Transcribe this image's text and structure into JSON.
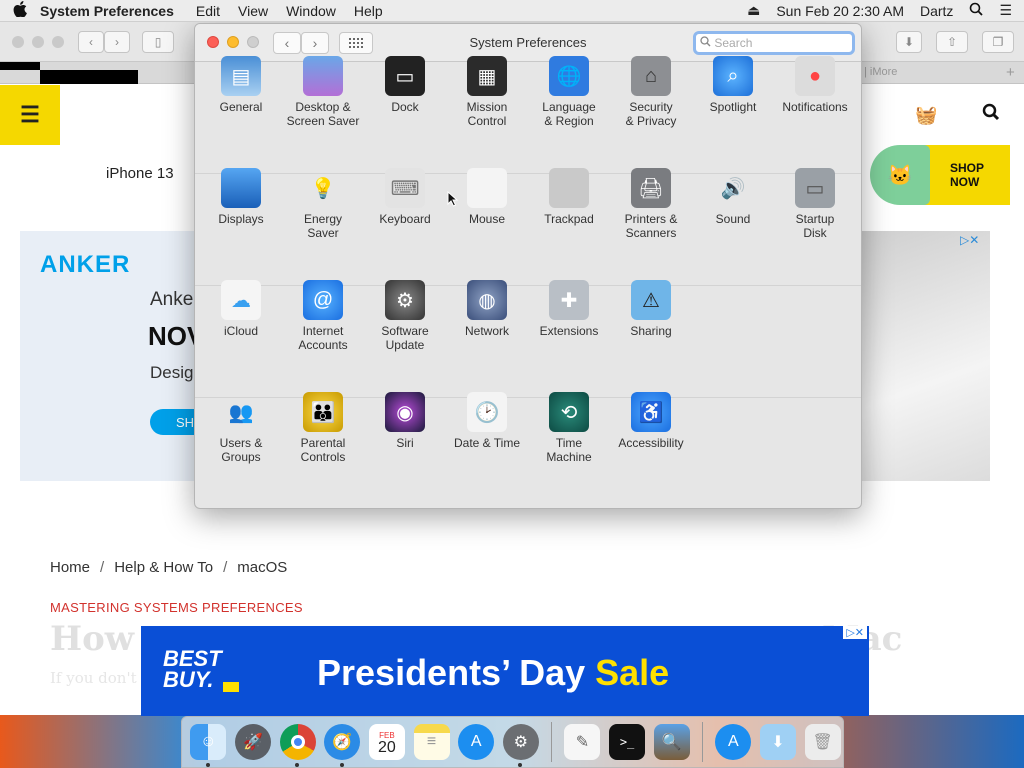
{
  "menubar": {
    "app_name": "System Preferences",
    "menus": [
      "Edit",
      "View",
      "Window",
      "Help"
    ],
    "datetime": "Sun Feb 20  2:30 AM",
    "user": "Dartz"
  },
  "browser": {
    "tab_label": "| iMore",
    "website": {
      "nav_iphone": "iPhone 13",
      "shop_now": "SHOP NOW",
      "ad": {
        "brand": "ANKER",
        "line1": "Anker",
        "line2": "NOV",
        "line3": "Design",
        "button": "SH"
      },
      "breadcrumb": [
        "Home",
        "Help & How To",
        "macOS"
      ],
      "kicker": "MASTERING SYSTEMS PREFERENCES",
      "title_start": "How",
      "title_end": "Mac",
      "subtitle": "If you don't"
    },
    "banner": {
      "logo_line1": "BEST",
      "logo_line2": "BUY.",
      "headline": "Presidents’ Day ",
      "headline_accent": "Sale"
    }
  },
  "sysprefs": {
    "title": "System Preferences",
    "search_placeholder": "Search",
    "sections": [
      [
        {
          "label": "General",
          "icon": "general-icon"
        },
        {
          "label": "Desktop &\nScreen Saver",
          "icon": "desktop-icon"
        },
        {
          "label": "Dock",
          "icon": "dock-icon"
        },
        {
          "label": "Mission\nControl",
          "icon": "mission-control-icon"
        },
        {
          "label": "Language\n& Region",
          "icon": "globe-icon"
        },
        {
          "label": "Security\n& Privacy",
          "icon": "house-lock-icon"
        },
        {
          "label": "Spotlight",
          "icon": "magnifier-icon"
        },
        {
          "label": "Notifications",
          "icon": "notifications-icon"
        }
      ],
      [
        {
          "label": "Displays",
          "icon": "display-icon"
        },
        {
          "label": "Energy\nSaver",
          "icon": "lightbulb-icon"
        },
        {
          "label": "Keyboard",
          "icon": "keyboard-icon"
        },
        {
          "label": "Mouse",
          "icon": "mouse-icon"
        },
        {
          "label": "Trackpad",
          "icon": "trackpad-icon"
        },
        {
          "label": "Printers &\nScanners",
          "icon": "printer-icon"
        },
        {
          "label": "Sound",
          "icon": "speaker-icon"
        },
        {
          "label": "Startup\nDisk",
          "icon": "disk-icon"
        }
      ],
      [
        {
          "label": "iCloud",
          "icon": "cloud-icon"
        },
        {
          "label": "Internet\nAccounts",
          "icon": "at-icon"
        },
        {
          "label": "Software\nUpdate",
          "icon": "gear-icon"
        },
        {
          "label": "Network",
          "icon": "network-globe-icon"
        },
        {
          "label": "Extensions",
          "icon": "puzzle-icon"
        },
        {
          "label": "Sharing",
          "icon": "sharing-folder-icon"
        }
      ],
      [
        {
          "label": "Users &\nGroups",
          "icon": "users-icon"
        },
        {
          "label": "Parental\nControls",
          "icon": "parental-icon"
        },
        {
          "label": "Siri",
          "icon": "siri-icon"
        },
        {
          "label": "Date & Time",
          "icon": "clock-icon"
        },
        {
          "label": "Time\nMachine",
          "icon": "time-machine-icon"
        },
        {
          "label": "Accessibility",
          "icon": "accessibility-icon"
        }
      ]
    ]
  },
  "dock": {
    "calendar_month": "FEB",
    "calendar_day": "20",
    "apps": [
      "finder",
      "launchpad",
      "chrome",
      "safari",
      "calendar",
      "notes",
      "app-store",
      "system-preferences",
      "textedit",
      "terminal",
      "preview",
      "app-store-folder",
      "downloads",
      "trash"
    ]
  }
}
